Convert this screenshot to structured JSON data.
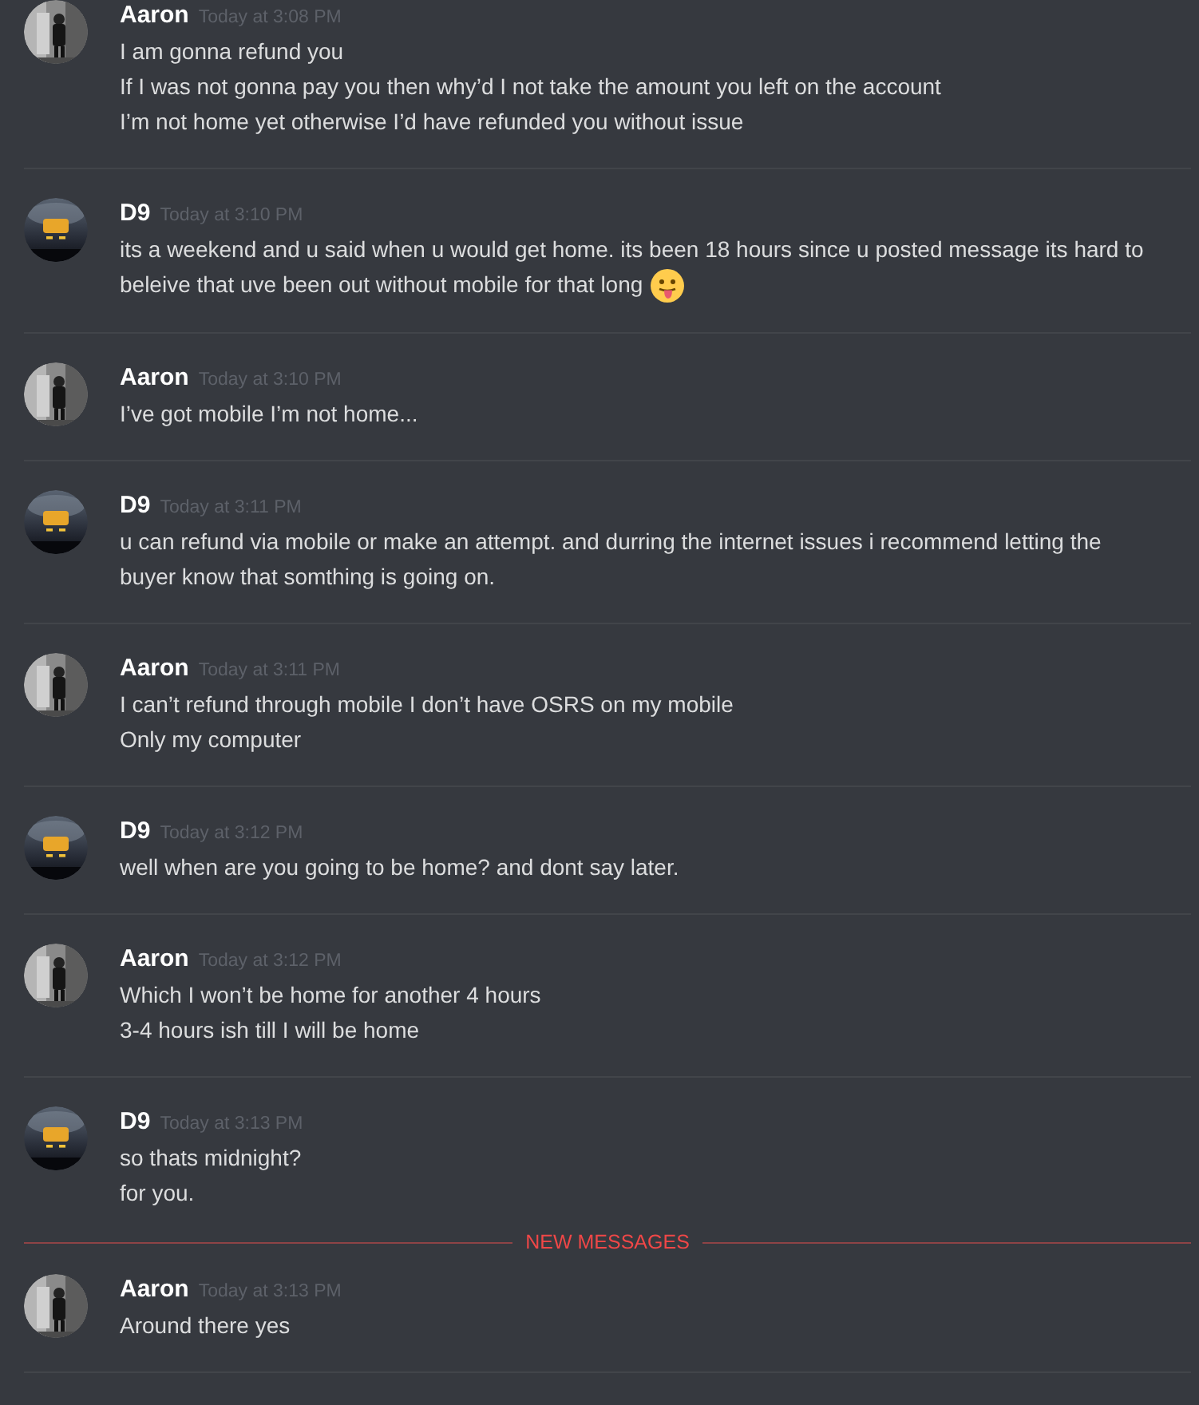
{
  "messages": [
    {
      "author": "Aaron",
      "time": "Today at 3:08 PM",
      "avatar": {
        "kind": "grayscale"
      },
      "lines": [
        {
          "text": "I am gonna refund you"
        },
        {
          "text": "If I was not gonna pay you then why’d I not take the amount you left on the account"
        },
        {
          "text": "I’m not home yet otherwise I’d have refunded you without issue"
        }
      ]
    },
    {
      "author": "D9",
      "time": "Today at 3:10 PM",
      "avatar": {
        "kind": "dark"
      },
      "lines": [
        {
          "text": "its a weekend and u said when u would get home. its been 18 hours since u posted message its hard to beleive that uve been out without mobile for that long",
          "kind": "emoji"
        }
      ]
    },
    {
      "author": "Aaron",
      "time": "Today at 3:10 PM",
      "avatar": {
        "kind": "grayscale"
      },
      "lines": [
        {
          "text": "I’ve got mobile I’m not home..."
        }
      ]
    },
    {
      "author": "D9",
      "time": "Today at 3:11 PM",
      "avatar": {
        "kind": "dark"
      },
      "lines": [
        {
          "text": "u can refund via mobile or make an attempt. and durring the internet issues i recommend letting the buyer know that somthing is going on."
        }
      ]
    },
    {
      "author": "Aaron",
      "time": "Today at 3:11 PM",
      "avatar": {
        "kind": "grayscale"
      },
      "lines": [
        {
          "text": "I can’t refund through mobile I don’t have OSRS on my mobile"
        },
        {
          "text": "Only my computer"
        }
      ]
    },
    {
      "author": "D9",
      "time": "Today at 3:12 PM",
      "avatar": {
        "kind": "dark"
      },
      "lines": [
        {
          "text": "well when are you going to be home? and dont say later."
        }
      ]
    },
    {
      "author": "Aaron",
      "time": "Today at 3:12 PM",
      "avatar": {
        "kind": "grayscale"
      },
      "lines": [
        {
          "text": "Which I won’t be home for another 4 hours"
        },
        {
          "text": "3-4 hours ish till I will be home"
        }
      ]
    },
    {
      "author": "D9",
      "time": "Today at 3:13 PM",
      "avatar": {
        "kind": "dark"
      },
      "lines": [
        {
          "text": "so thats midnight?"
        },
        {
          "text": "for you."
        }
      ]
    },
    {
      "kind": "divider",
      "label": "NEW MESSAGES"
    },
    {
      "author": "Aaron",
      "time": "Today at 3:13 PM",
      "avatar": {
        "kind": "grayscale"
      },
      "lines": [
        {
          "text": "Around there yes"
        }
      ]
    }
  ]
}
